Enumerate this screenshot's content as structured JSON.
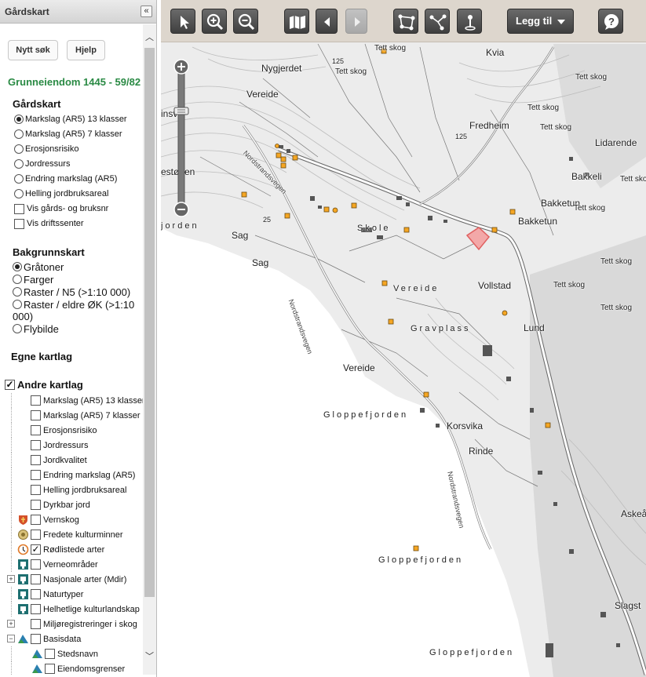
{
  "panel": {
    "title": "Gårdskart",
    "collapse_glyph": "«",
    "new_search": "Nytt søk",
    "help": "Hjelp",
    "property_title": "Grunneiendom 1445 - 59/82",
    "gardskart_heading": "Gårdskart",
    "gardskart_options": [
      {
        "label": "Markslag (AR5) 13 klasser",
        "selected": true
      },
      {
        "label": "Markslag (AR5) 7 klasser",
        "selected": false
      },
      {
        "label": "Erosjonsrisiko",
        "selected": false
      },
      {
        "label": "Jordressurs",
        "selected": false
      },
      {
        "label": "Endring markslag (AR5)",
        "selected": false
      },
      {
        "label": "Helling jordbruksareal",
        "selected": false
      }
    ],
    "gardskart_checks": [
      {
        "label": "Vis gårds- og bruksnr",
        "checked": false
      },
      {
        "label": "Vis driftssenter",
        "checked": false
      }
    ],
    "background_heading": "Bakgrunnskart",
    "background_options": [
      {
        "label": "Gråtoner",
        "selected": true
      },
      {
        "label": "Farger",
        "selected": false
      },
      {
        "label": "Raster / N5 (>1:10 000)",
        "selected": false
      },
      {
        "label": "Raster / eldre ØK (>1:10",
        "label2": "000)",
        "selected": false
      },
      {
        "label": "Flybilde",
        "selected": false
      }
    ],
    "own_layers_heading": "Egne kartlag",
    "other_layers_heading": "Andre kartlag",
    "other_layers_checked": true,
    "layers": [
      {
        "label": "Markslag (AR5) 13 klasser",
        "checked": false,
        "icon": "none"
      },
      {
        "label": "Markslag (AR5) 7 klasser",
        "checked": false,
        "icon": "none"
      },
      {
        "label": "Erosjonsrisiko",
        "checked": false,
        "icon": "none"
      },
      {
        "label": "Jordressurs",
        "checked": false,
        "icon": "none"
      },
      {
        "label": "Jordkvalitet",
        "checked": false,
        "icon": "none"
      },
      {
        "label": "Endring markslag (AR5)",
        "checked": false,
        "icon": "none"
      },
      {
        "label": "Helling jordbruksareal",
        "checked": false,
        "icon": "none"
      },
      {
        "label": "Dyrkbar jord",
        "checked": false,
        "icon": "none"
      },
      {
        "label": "Vernskog",
        "checked": false,
        "icon": "shield-icon"
      },
      {
        "label": "Fredete kulturminner",
        "checked": false,
        "icon": "monument-icon"
      },
      {
        "label": "Rødlistede arter",
        "checked": true,
        "icon": "redlist-icon"
      },
      {
        "label": "Verneområder",
        "checked": false,
        "icon": "protected-area-icon"
      },
      {
        "label": "Nasjonale arter (Mdir)",
        "checked": false,
        "icon": "protected-area-icon",
        "expander": "+"
      },
      {
        "label": "Naturtyper",
        "checked": false,
        "icon": "protected-area-icon"
      },
      {
        "label": "Helhetlige kulturlandskap",
        "checked": false,
        "icon": "protected-area-icon"
      },
      {
        "label": "Miljøregistreringer i skog",
        "checked": false,
        "icon": "none",
        "expander": "+"
      },
      {
        "label": "Basisdata",
        "checked": false,
        "icon": "basedata-icon",
        "expander": "−"
      },
      {
        "label": "Stedsnavn",
        "checked": false,
        "icon": "basedata-icon",
        "child": true
      },
      {
        "label": "Eiendomsgrenser",
        "checked": false,
        "icon": "basedata-icon",
        "child": true
      }
    ]
  },
  "toolbar": {
    "add_label": "Legg til",
    "tools": [
      "select-tool",
      "zoom-in",
      "zoom-out",
      "map-overview",
      "back",
      "forward",
      "measure-area",
      "measure-line",
      "point-info",
      "help"
    ]
  },
  "map": {
    "labels": [
      {
        "text": "Tett skog",
        "kind": "small"
      },
      {
        "text": "Kvia",
        "kind": "place"
      },
      {
        "text": "Nygjerdet",
        "kind": "place"
      },
      {
        "text": "Tett skog",
        "kind": "small"
      },
      {
        "text": "125",
        "kind": "contour"
      },
      {
        "text": "Tett skog",
        "kind": "small"
      },
      {
        "text": "Vereide",
        "kind": "place"
      },
      {
        "text": "Tett skog",
        "kind": "small"
      },
      {
        "text": "Fredheim",
        "kind": "place"
      },
      {
        "text": "Tett skog",
        "kind": "small"
      },
      {
        "text": "125",
        "kind": "contour"
      },
      {
        "text": "Lidarende",
        "kind": "place"
      },
      {
        "text": "estønen",
        "kind": "place"
      },
      {
        "text": "Bakkeli",
        "kind": "place"
      },
      {
        "text": "Tett skog",
        "kind": "small"
      },
      {
        "text": "Bakketun",
        "kind": "place"
      },
      {
        "text": "Tett skog",
        "kind": "small"
      },
      {
        "text": "Bakketun",
        "kind": "place"
      },
      {
        "text": "Tett skog",
        "kind": "small"
      },
      {
        "text": "jorden",
        "kind": "water"
      },
      {
        "text": "Sag",
        "kind": "place"
      },
      {
        "text": "25",
        "kind": "contour"
      },
      {
        "text": "Skole",
        "kind": "spaced"
      },
      {
        "text": "Sag",
        "kind": "place"
      },
      {
        "text": "Tett skog",
        "kind": "small"
      },
      {
        "text": "Vereide",
        "kind": "spaced"
      },
      {
        "text": "Vollstad",
        "kind": "place"
      },
      {
        "text": "Tett skog",
        "kind": "small"
      },
      {
        "text": "Gravplass",
        "kind": "spaced"
      },
      {
        "text": "Lund",
        "kind": "place"
      },
      {
        "text": "Vereide",
        "kind": "place"
      },
      {
        "text": "Gloppefjorden",
        "kind": "water"
      },
      {
        "text": "Korsvika",
        "kind": "place"
      },
      {
        "text": "Rinde",
        "kind": "place"
      },
      {
        "text": "Askeå",
        "kind": "place"
      },
      {
        "text": "Gloppefjorden",
        "kind": "water"
      },
      {
        "text": "Slagst",
        "kind": "place"
      },
      {
        "text": "Gloppefjorden",
        "kind": "water"
      },
      {
        "text": "Nordstrandsvegen",
        "kind": "road"
      },
      {
        "text": "Nordstrandsvegen",
        "kind": "road"
      },
      {
        "text": "Nordstrandsvegen",
        "kind": "road"
      },
      {
        "text": "insvi",
        "kind": "place"
      }
    ]
  }
}
